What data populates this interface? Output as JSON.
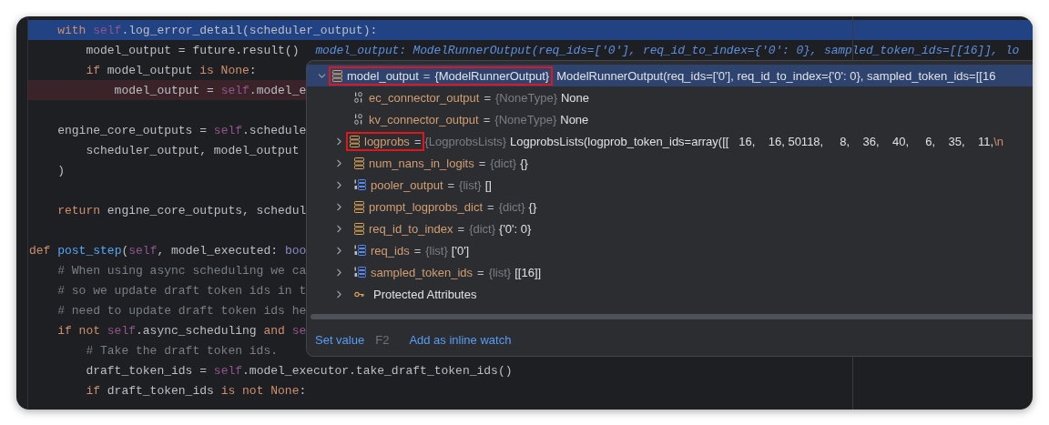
{
  "editor": {
    "previous_body": [
      {
        "kind": "code",
        "current": true,
        "error": false,
        "tokens": [
          {
            "kind": "kw",
            "text": "with "
          },
          {
            "kind": "self",
            "text": "self"
          },
          {
            "kind": "plain",
            "text": ".log_error_detail(scheduler_output):"
          }
        ],
        "children": [
          {
            "kind": "code",
            "current": false,
            "error": false,
            "tokens": [
              {
                "kind": "plain",
                "text": "model_output = future.result()"
              }
            ],
            "hint": "model_output: ModelRunnerOutput(req_ids=['0'], req_id_to_index={'0': 0}, sampled_token_ids=[[16]], lo"
          },
          {
            "kind": "code",
            "current": false,
            "error": false,
            "tokens": [
              {
                "kind": "kw",
                "text": "if "
              },
              {
                "kind": "plain",
                "text": "model_output "
              },
              {
                "kind": "kw",
                "text": "is None"
              },
              {
                "kind": "plain",
                "text": ":"
              }
            ],
            "children": [
              {
                "kind": "code",
                "current": false,
                "error": true,
                "tokens": [
                  {
                    "kind": "plain",
                    "text": "model_output = "
                  },
                  {
                    "kind": "self",
                    "text": "self"
                  },
                  {
                    "kind": "plain",
                    "text": ".model_e"
                  }
                ]
              }
            ]
          }
        ]
      },
      {
        "kind": "blank"
      },
      {
        "kind": "code",
        "current": false,
        "error": false,
        "tokens": [
          {
            "kind": "plain",
            "text": "engine_core_outputs = "
          },
          {
            "kind": "self",
            "text": "self"
          },
          {
            "kind": "plain",
            "text": ".schedule"
          }
        ],
        "children": [
          {
            "kind": "code",
            "current": false,
            "error": false,
            "tokens": [
              {
                "kind": "plain",
                "text": "scheduler_output, model_output"
              }
            ]
          }
        ]
      },
      {
        "kind": "code",
        "current": false,
        "error": false,
        "tokens": [
          {
            "kind": "plain",
            "text": ")"
          }
        ]
      },
      {
        "kind": "blank"
      },
      {
        "kind": "code",
        "current": false,
        "error": false,
        "tokens": [
          {
            "kind": "kw",
            "text": "return "
          },
          {
            "kind": "plain",
            "text": "engine_core_outputs, schedul"
          }
        ]
      },
      {
        "kind": "blank"
      }
    ],
    "lines": [
      {
        "kind": "code",
        "current": false,
        "error": false,
        "tokens": [
          {
            "kind": "kw",
            "text": "def "
          },
          {
            "kind": "fn",
            "text": "post_step"
          },
          {
            "kind": "plain",
            "text": "("
          },
          {
            "kind": "self",
            "text": "self"
          },
          {
            "kind": "plain",
            "text": ", model_executed: "
          },
          {
            "kind": "type",
            "text": "boo"
          }
        ],
        "children": [
          {
            "kind": "code",
            "current": false,
            "error": false,
            "tokens": [
              {
                "kind": "comment",
                "text": "# When using async scheduling we ca"
              }
            ]
          },
          {
            "kind": "code",
            "current": false,
            "error": false,
            "tokens": [
              {
                "kind": "comment",
                "text": "# so we update draft token ids in t"
              }
            ]
          },
          {
            "kind": "code",
            "current": false,
            "error": false,
            "tokens": [
              {
                "kind": "comment",
                "text": "# need to update draft token ids he"
              }
            ]
          },
          {
            "kind": "code",
            "current": false,
            "error": false,
            "tokens": [
              {
                "kind": "kw",
                "text": "if not "
              },
              {
                "kind": "self",
                "text": "self"
              },
              {
                "kind": "plain",
                "text": ".async_scheduling "
              },
              {
                "kind": "kw",
                "text": "and "
              },
              {
                "kind": "self",
                "text": "se"
              }
            ],
            "children": [
              {
                "kind": "code",
                "current": false,
                "error": false,
                "tokens": [
                  {
                    "kind": "comment",
                    "text": "# Take the draft token ids."
                  }
                ]
              },
              {
                "kind": "code",
                "current": false,
                "error": false,
                "tokens": [
                  {
                    "kind": "plain",
                    "text": "draft_token_ids = "
                  },
                  {
                    "kind": "self",
                    "text": "self"
                  },
                  {
                    "kind": "plain",
                    "text": ".model_executor.take_draft_token_ids()"
                  }
                ]
              },
              {
                "kind": "code",
                "current": false,
                "error": false,
                "tokens": [
                  {
                    "kind": "kw",
                    "text": "if "
                  },
                  {
                    "kind": "plain",
                    "text": "draft_token_ids "
                  },
                  {
                    "kind": "kw",
                    "text": "is not None"
                  },
                  {
                    "kind": "plain",
                    "text": ":"
                  }
                ]
              }
            ]
          }
        ]
      }
    ]
  },
  "variables_popup": {
    "root": {
      "kind": "object",
      "name": "model_output",
      "equals": "=",
      "type": "{ModelRunnerOutput}",
      "value": "ModelRunnerOutput(req_ids=['0'], req_id_to_index={'0': 0}, sampled_token_ids=[[16",
      "expanded": true,
      "selected": true,
      "framed": true,
      "frame_covers_type": true,
      "children": [
        {
          "kind": "binary",
          "name": "ec_connector_output",
          "equals": "=",
          "type": "{NoneType}",
          "value": "None",
          "selected": false,
          "framed": false
        },
        {
          "kind": "binary",
          "name": "kv_connector_output",
          "equals": "=",
          "type": "{NoneType}",
          "value": "None",
          "selected": false,
          "framed": false
        },
        {
          "kind": "object",
          "name": "logprobs",
          "equals": "=",
          "type": "{LogprobsLists}",
          "value": "LogprobsLists(logprob_token_ids=array([[   16,    16, 50118,     8,    36,    40,     6,    35,    11,",
          "escape": "\\n",
          "expanded": false,
          "selected": false,
          "framed": true,
          "frame_covers_type": false
        },
        {
          "kind": "object",
          "name": "num_nans_in_logits",
          "equals": "=",
          "type": "{dict}",
          "value": "{}",
          "expanded": false,
          "selected": false,
          "framed": false
        },
        {
          "kind": "list",
          "name": "pooler_output",
          "equals": "=",
          "type": "{list}",
          "value": "[]",
          "expanded": false,
          "selected": false,
          "framed": false
        },
        {
          "kind": "object",
          "name": "prompt_logprobs_dict",
          "equals": "=",
          "type": "{dict}",
          "value": "{}",
          "expanded": false,
          "selected": false,
          "framed": false
        },
        {
          "kind": "object",
          "name": "req_id_to_index",
          "equals": "=",
          "type": "{dict}",
          "value": "{'0': 0}",
          "expanded": false,
          "selected": false,
          "framed": false
        },
        {
          "kind": "list",
          "name": "req_ids",
          "equals": "=",
          "type": "{list}",
          "value": "['0']",
          "expanded": false,
          "selected": false,
          "framed": false
        },
        {
          "kind": "list",
          "name": "sampled_token_ids",
          "equals": "=",
          "type": "{list}",
          "value": "[[16]]",
          "expanded": false,
          "selected": false,
          "framed": false
        },
        {
          "kind": "attributes",
          "name": "Protected Attributes",
          "expanded": false,
          "selected": false,
          "framed": false
        }
      ]
    },
    "actions": [
      {
        "label": "Set value",
        "shortcut": "F2"
      },
      {
        "label": "Add as inline watch"
      }
    ]
  }
}
